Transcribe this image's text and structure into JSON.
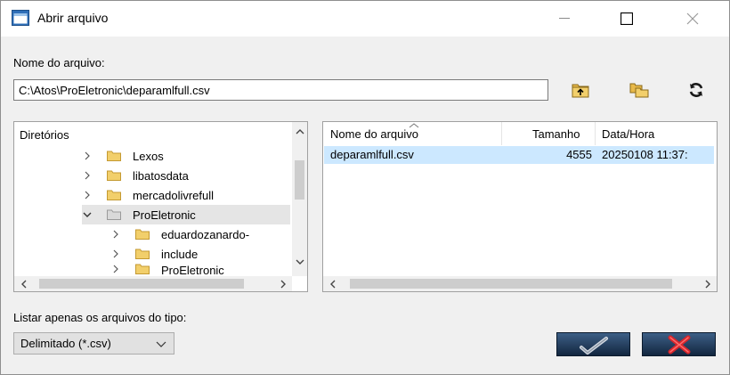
{
  "window": {
    "title": "Abrir arquivo",
    "icon": "app-window-icon",
    "controls": [
      "minimize-icon",
      "maximize-icon",
      "close-icon"
    ]
  },
  "filename": {
    "label": "Nome do arquivo:",
    "value": "C:\\Atos\\ProEletronic\\deparamlfull.csv"
  },
  "toolbar": {
    "buttons": [
      "folder-up-icon",
      "folders-icon",
      "refresh-icon"
    ]
  },
  "directories": {
    "header": "Diretórios",
    "items": [
      {
        "label": "Lexos",
        "expanded": false
      },
      {
        "label": "libatosdata",
        "expanded": false
      },
      {
        "label": "mercadolivrefull",
        "expanded": false
      },
      {
        "label": "ProEletronic",
        "expanded": true
      },
      {
        "label": "eduardozanardo-",
        "expanded": false
      },
      {
        "label": "include",
        "expanded": false
      },
      {
        "label": "ProEletronic",
        "expanded": false
      }
    ]
  },
  "files": {
    "columns": [
      "Nome do arquivo",
      "Tamanho",
      "Data/Hora"
    ],
    "rows": [
      {
        "name": "deparamlfull.csv",
        "size": "4555",
        "datetime": "20250108 11:37:"
      }
    ]
  },
  "filetype": {
    "label": "Listar apenas os arquivos do tipo:",
    "selected": "Delimitado (*.csv)"
  },
  "colors": {
    "selection": "#cce8ff",
    "tree_selection": "#e5e5e5",
    "button_dark": "#1f3a5c",
    "cancel_red": "#d6262c"
  }
}
